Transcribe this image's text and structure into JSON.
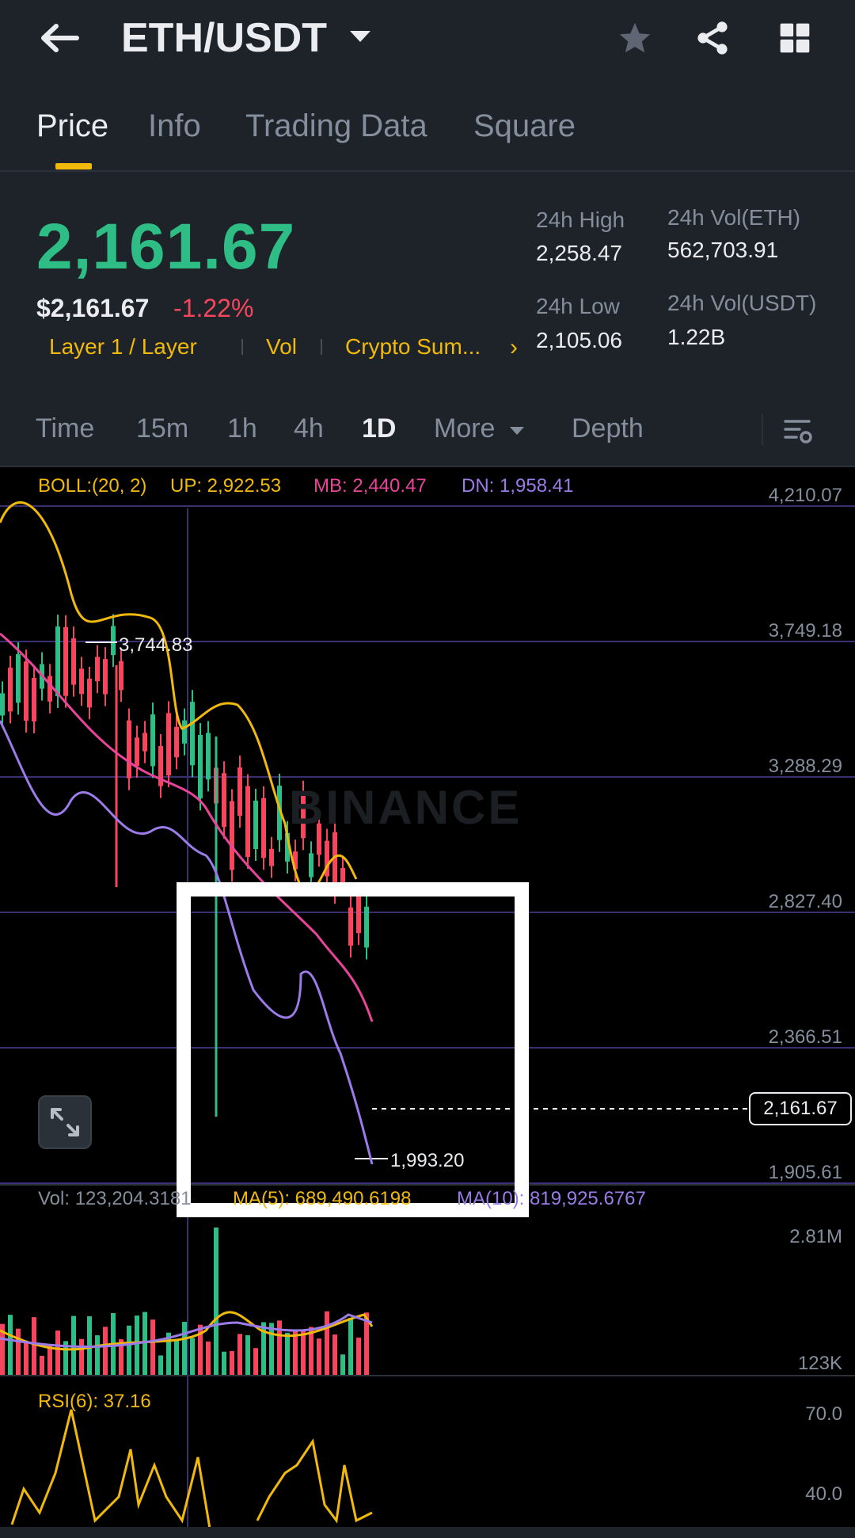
{
  "header": {
    "back_icon": "back-arrow-icon",
    "title": "ETH/USDT",
    "dropdown_icon": "caret-down-icon",
    "star_icon": "star-icon",
    "share_icon": "share-icon",
    "grid_icon": "grid-icon"
  },
  "tabs": [
    {
      "label": "Price",
      "active": true
    },
    {
      "label": "Info"
    },
    {
      "label": "Trading Data"
    },
    {
      "label": "Square"
    }
  ],
  "price": {
    "last": "2,161.67",
    "fiat": "$2,161.67",
    "change": "-1.22%",
    "tags": [
      "Layer 1 / Layer",
      "Vol",
      "Crypto Sum..."
    ],
    "tags_chevron": "›"
  },
  "stats": {
    "high_label": "24h High",
    "high_value": "2,258.47",
    "low_label": "24h Low",
    "low_value": "2,105.06",
    "vol_eth_label": "24h Vol(ETH)",
    "vol_eth_value": "562,703.91",
    "vol_usdt_label": "24h Vol(USDT)",
    "vol_usdt_value": "1.22B"
  },
  "intervals": [
    "Time",
    "15m",
    "1h",
    "4h",
    "1D",
    "More",
    "Depth"
  ],
  "active_interval": "1D",
  "chart": {
    "boll": "BOLL:(20, 2)",
    "boll_up": "UP: 2,922.53",
    "boll_mb": "MB: 2,440.47",
    "boll_dn": "DN: 1,958.41",
    "y_labels": [
      "4,210.07",
      "3,749.18",
      "3,288.29",
      "2,827.40",
      "2,366.51",
      "1,905.61"
    ],
    "high_marker": "3,744.83",
    "low_marker": "1,993.20",
    "current_price": "2,161.67",
    "watermark": "BINANCE",
    "vol": "Vol: 123,204.3181",
    "vol_ma5": "MA(5): 689,490.6198",
    "vol_ma10": "MA(10): 819,925.6767",
    "vol_max": "2.81M",
    "vol_min": "123K",
    "rsi": "RSI(6): 37.16",
    "rsi_70": "70.0",
    "rsi_40": "40.0"
  },
  "colors": {
    "up": "#2ebd85",
    "down": "#f6465d",
    "accent": "#f0b90b",
    "boll_up": "#f0b90b",
    "boll_mb": "#e8459a",
    "boll_dn": "#9a7be8"
  }
}
